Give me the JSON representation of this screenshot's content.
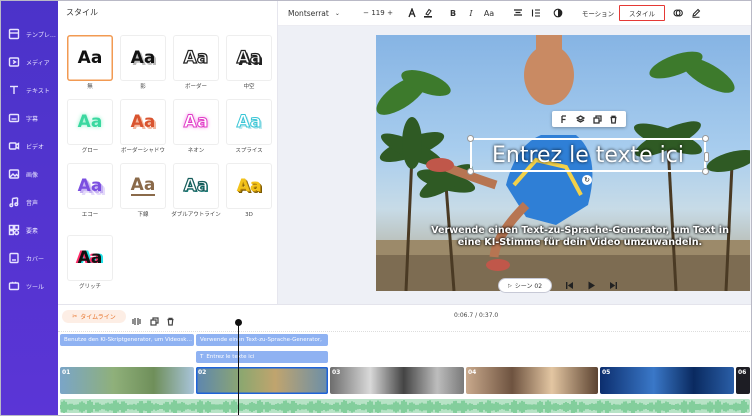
{
  "sidebar": {
    "items": [
      {
        "label": "テンプレ…",
        "icon": "template-icon"
      },
      {
        "label": "メディア",
        "icon": "media-icon"
      },
      {
        "label": "テキスト",
        "icon": "text-icon"
      },
      {
        "label": "字幕",
        "icon": "subtitle-icon"
      },
      {
        "label": "ビデオ",
        "icon": "video-icon"
      },
      {
        "label": "画像",
        "icon": "image-icon"
      },
      {
        "label": "音声",
        "icon": "audio-icon"
      },
      {
        "label": "要素",
        "icon": "elements-icon"
      },
      {
        "label": "カバー",
        "icon": "cover-icon"
      },
      {
        "label": "ツール",
        "icon": "tools-icon"
      }
    ]
  },
  "style_panel": {
    "title": "スタイル",
    "styles": [
      {
        "label": "無",
        "sample": "Aa",
        "selected": true
      },
      {
        "label": "影",
        "sample": "Aa",
        "selected": false
      },
      {
        "label": "ボーダー",
        "sample": "Aa",
        "selected": false
      },
      {
        "label": "中空",
        "sample": "Aa",
        "selected": false
      },
      {
        "label": "グロー",
        "sample": "Aa",
        "selected": false
      },
      {
        "label": "ボーダーシャドウ",
        "sample": "Aa",
        "selected": false
      },
      {
        "label": "ネオン",
        "sample": "Aa",
        "selected": false
      },
      {
        "label": "スプライス",
        "sample": "Aa",
        "selected": false
      },
      {
        "label": "エコー",
        "sample": "Aa",
        "selected": false
      },
      {
        "label": "下線",
        "sample": "Aa",
        "selected": false
      },
      {
        "label": "ダブルアウトライン",
        "sample": "Aa",
        "selected": false
      },
      {
        "label": "3D",
        "sample": "Aa",
        "selected": false
      },
      {
        "label": "グリッチ",
        "sample": "Aa",
        "selected": false
      }
    ]
  },
  "toolbar": {
    "font": "Montserrat",
    "font_size": "119",
    "minus": "−",
    "plus": "+",
    "case_label": "Aa",
    "bold_label": "B",
    "italic_label": "I",
    "motion_tab": "モーション",
    "style_tab": "スタイル",
    "style_tab_highlight": "#e53935"
  },
  "canvas": {
    "headline": "Entrez le texte ici",
    "subtitle": "Verwende einen Text-zu-Sprache-Generator, um Text in eine KI-Stimme für dein Video umzuwandeln."
  },
  "player": {
    "scene_label": "シーン 02"
  },
  "timeline": {
    "tab_label": "タイムライン",
    "timecode": "0:06.7 / 0:37.0",
    "subtitle_tracks": [
      "Benutze den KI-Skriptgenerator, um Videosk…",
      "Verwende einen Text-zu-Sprache-Generator,"
    ],
    "text_track": "Entrez le texte ici",
    "clips": [
      "01",
      "02",
      "03",
      "04",
      "05",
      "06"
    ]
  },
  "colors": {
    "accent": "#5b35d6",
    "timeline_accent": "#e8762e",
    "track_blue": "#8fb2f2",
    "audio_green": "#b7e3c6"
  }
}
